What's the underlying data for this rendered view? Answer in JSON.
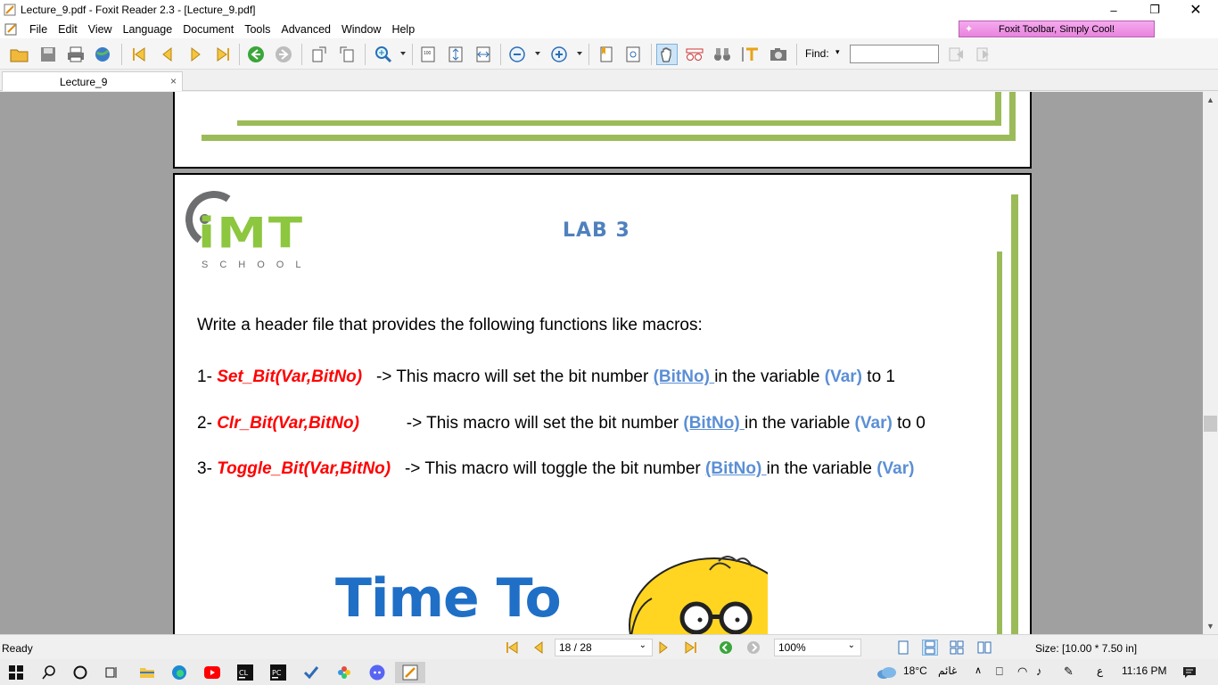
{
  "window": {
    "title": "Lecture_9.pdf - Foxit Reader 2.3 - [Lecture_9.pdf]"
  },
  "menu": {
    "items": [
      "File",
      "Edit",
      "View",
      "Language",
      "Document",
      "Tools",
      "Advanced",
      "Window",
      "Help"
    ]
  },
  "promo": {
    "label": "Foxit Toolbar, Simply Cool!"
  },
  "toolbar": {
    "find_label": "Find:",
    "find_value": "",
    "find_dropdown": "▾"
  },
  "tab": {
    "label": "Lecture_9",
    "close": "×"
  },
  "document": {
    "logo_text": "iMT",
    "logo_school": "SCHOOL",
    "lab_title": "LAB 3",
    "intro": "Write a header file that provides the following functions like macros:",
    "lines": [
      {
        "num": "1- ",
        "fn": "Set_Bit(Var,BitNo)",
        "spacer": "   ",
        "arrow_text": "-> This macro will set the bit number ",
        "bitno": "(BitNo) ",
        "mid": "in the variable ",
        "var": "(Var)",
        "tail": " to 1"
      },
      {
        "num": "2- ",
        "fn": "Clr_Bit(Var,BitNo)",
        "spacer": "          ",
        "arrow_text": "-> This macro will set the bit number ",
        "bitno": "(BitNo) ",
        "mid": "in the variable ",
        "var": "(Var)",
        "tail": " to 0"
      },
      {
        "num": "3- ",
        "fn": "Toggle_Bit(Var,BitNo)",
        "spacer": "   ",
        "arrow_text": "-> This macro will toggle the bit number ",
        "bitno": "(BitNo) ",
        "mid": "in the variable ",
        "var": "(Var)",
        "tail": ""
      }
    ],
    "time_to": "Time To"
  },
  "status": {
    "ready": "Ready",
    "page": "18 / 28",
    "zoom": "100%",
    "size": "Size: [10.00 * 7.50 in]"
  },
  "taskbar": {
    "weather": "18°C",
    "weather_desc": "غائم",
    "lang": "ع",
    "time": "11:16 PM"
  },
  "colors": {
    "accent_green": "#9bbb59",
    "logo_green": "#8dc63f",
    "macro_red": "#ff0000",
    "var_blue": "#5b8fd5",
    "lab_blue": "#4f81bd",
    "time_blue": "#1f6fc6"
  }
}
